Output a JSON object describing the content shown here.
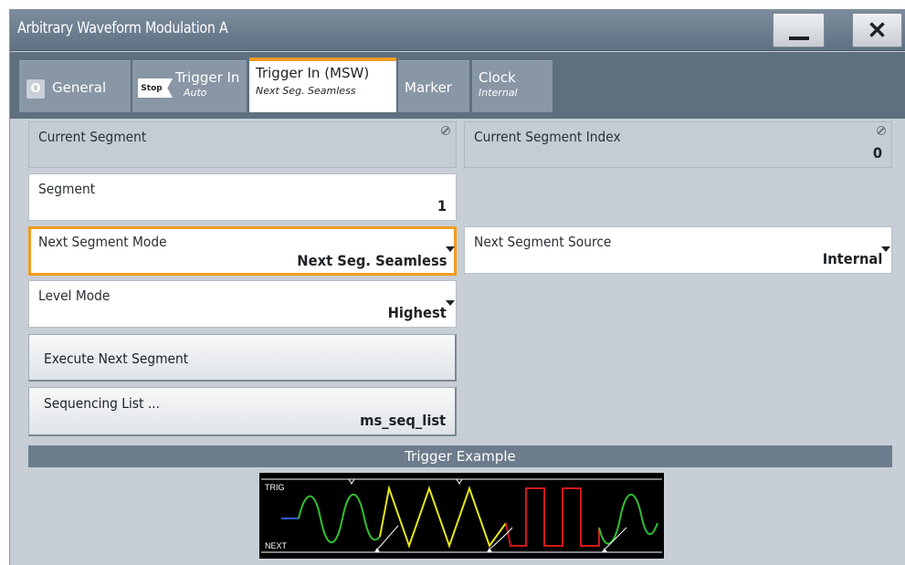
{
  "window": {
    "title": "Arbitrary Waveform Modulation A",
    "minimize_icon": "minimize-icon",
    "close_label": "✕"
  },
  "tabs": [
    {
      "badge": "O",
      "label": "General",
      "sub": ""
    },
    {
      "badge": "Stop",
      "label": "Trigger In",
      "sub": "Auto"
    },
    {
      "badge": "",
      "label": "Trigger In (MSW)",
      "sub": "Next Seg. Seamless",
      "active": true
    },
    {
      "badge": "",
      "label": "Marker",
      "sub": ""
    },
    {
      "badge": "",
      "label": "Clock",
      "sub": "Internal"
    }
  ],
  "fields": {
    "current_segment": {
      "label": "Current Segment",
      "value": ""
    },
    "current_segment_index": {
      "label": "Current Segment Index",
      "value": "0"
    },
    "segment": {
      "label": "Segment",
      "value": "1"
    },
    "next_segment_mode": {
      "label": "Next Segment Mode",
      "value": "Next Seg. Seamless"
    },
    "next_segment_source": {
      "label": "Next Segment Source",
      "value": "Internal"
    },
    "level_mode": {
      "label": "Level Mode",
      "value": "Highest"
    }
  },
  "buttons": {
    "execute_next_segment": {
      "label": "Execute Next Segment"
    },
    "sequencing_list": {
      "label": "Sequencing List ...",
      "value": "ms_seq_list"
    }
  },
  "trigger_example": {
    "title": "Trigger Example",
    "trig_label": "TRIG",
    "next_label": "NEXT"
  },
  "colors": {
    "accent": "#f39c1e",
    "sine": "#2fbf2f",
    "triangle": "#e6e617",
    "square": "#d21818"
  }
}
